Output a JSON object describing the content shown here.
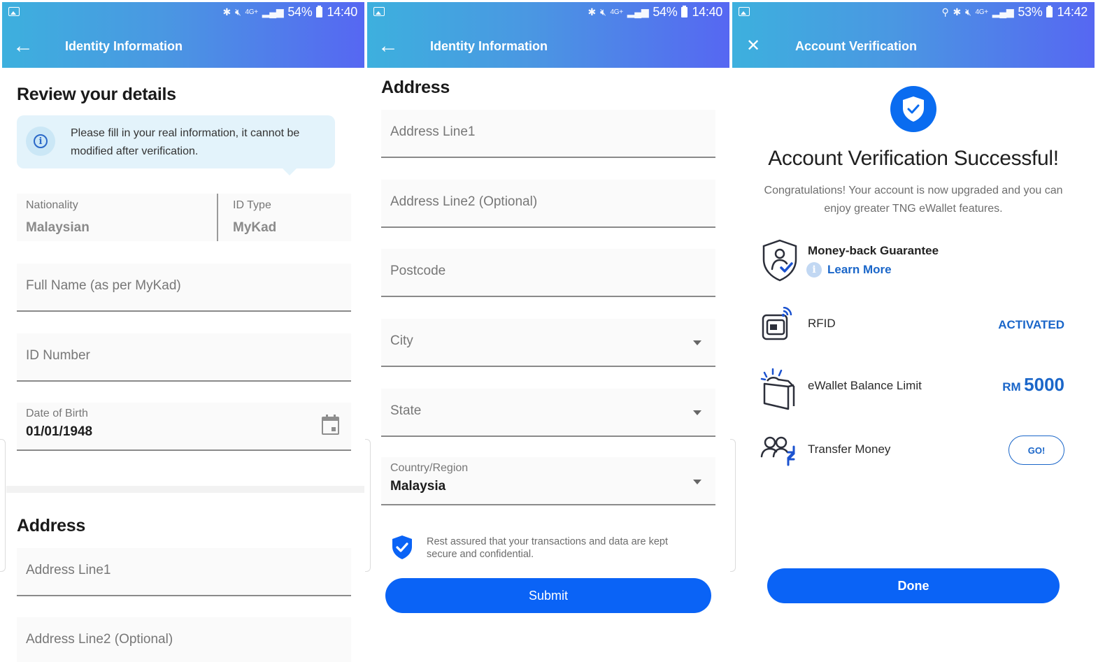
{
  "screens": [
    {
      "status": {
        "time": "14:40",
        "battery": "54%",
        "network": "4G+",
        "icons": [
          "gallery-icon",
          "bluetooth-icon",
          "mute-icon",
          "signal-icon",
          "battery-icon"
        ]
      },
      "appbar": {
        "title": "Identity Information",
        "nav_icon": "back-arrow-icon",
        "nav_glyph": "←"
      },
      "heading": "Review your details",
      "notice": {
        "icon": "info-icon",
        "text": "Please fill in your real information, it cannot be modified after verification."
      },
      "nationality": {
        "label": "Nationality",
        "value": "Malaysian"
      },
      "id_type": {
        "label": "ID Type",
        "value": "MyKad"
      },
      "full_name": {
        "placeholder": "Full Name (as per MyKad)",
        "value": ""
      },
      "id_number": {
        "placeholder": "ID Number",
        "value": ""
      },
      "dob": {
        "label": "Date of Birth",
        "value": "01/01/1948",
        "icon": "calendar-icon"
      },
      "address_heading": "Address",
      "address_line1": {
        "placeholder": "Address Line1",
        "value": ""
      },
      "address_line2": {
        "placeholder": "Address Line2 (Optional)",
        "value": ""
      }
    },
    {
      "status": {
        "time": "14:40",
        "battery": "54%",
        "network": "4G+",
        "icons": [
          "gallery-icon",
          "bluetooth-icon",
          "mute-icon",
          "signal-icon",
          "battery-icon"
        ]
      },
      "appbar": {
        "title": "Identity Information",
        "nav_icon": "back-arrow-icon",
        "nav_glyph": "←"
      },
      "address_heading": "Address",
      "address_line1": {
        "placeholder": "Address Line1",
        "value": ""
      },
      "address_line2": {
        "placeholder": "Address Line2 (Optional)",
        "value": ""
      },
      "postcode": {
        "placeholder": "Postcode",
        "value": ""
      },
      "city": {
        "placeholder": "City",
        "value": ""
      },
      "state": {
        "placeholder": "State",
        "value": ""
      },
      "country": {
        "label": "Country/Region",
        "value": "Malaysia"
      },
      "secure_note": "Rest assured that your transactions and data are kept secure and confidential.",
      "submit_label": "Submit"
    },
    {
      "status": {
        "time": "14:42",
        "battery": "53%",
        "network": "4G+",
        "icons": [
          "gallery-icon",
          "location-icon",
          "bluetooth-icon",
          "mute-icon",
          "signal-icon",
          "battery-icon"
        ]
      },
      "appbar": {
        "title": "Account Verification",
        "nav_icon": "close-icon",
        "nav_glyph": "✕"
      },
      "title": "Account Verification Successful!",
      "subtitle": "Congratulations! Your account is now upgraded and you can enjoy greater TNG eWallet features.",
      "features": [
        {
          "icon": "shield-user-icon",
          "name": "Money-back Guarantee",
          "link": "Learn More"
        },
        {
          "icon": "rfid-card-icon",
          "name": "RFID",
          "status": "ACTIVATED"
        },
        {
          "icon": "wallet-icon",
          "name": "eWallet Balance Limit",
          "currency": "RM",
          "amount": "5000"
        },
        {
          "icon": "transfer-users-icon",
          "name": "Transfer Money",
          "action": "GO!"
        }
      ],
      "done_label": "Done"
    }
  ],
  "colors": {
    "primary": "#0a63f6",
    "link": "#1a66c9",
    "appbar_start": "#3db0de",
    "appbar_end": "#5667f2",
    "notice_bg": "#e3f3fb"
  }
}
